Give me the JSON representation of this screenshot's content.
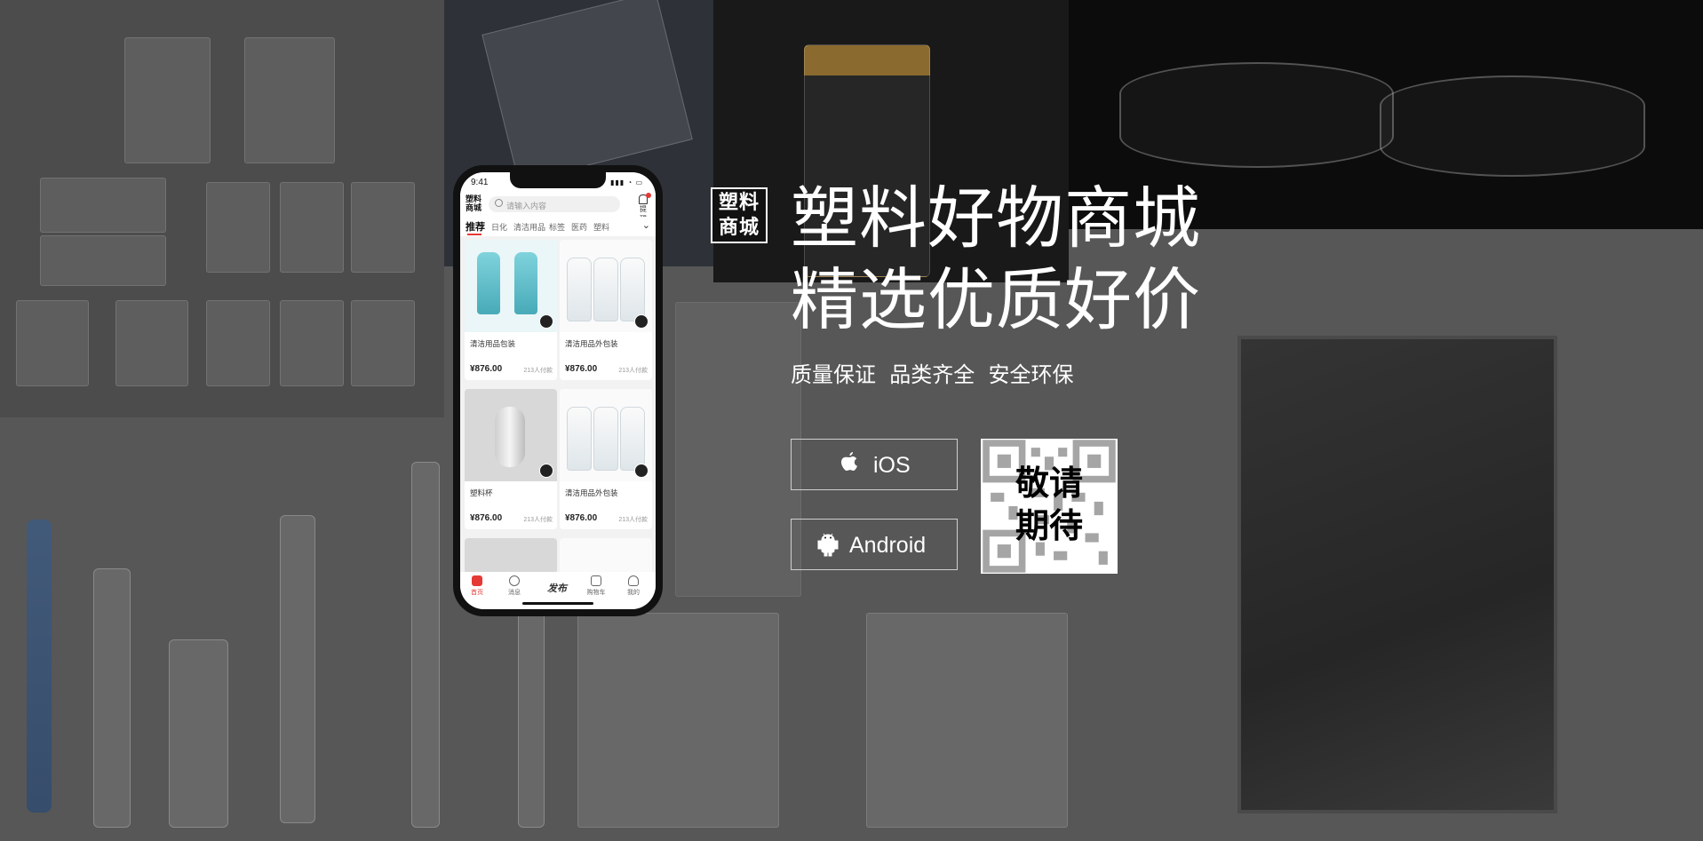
{
  "brand": {
    "logo_line1": "塑料",
    "logo_line2": "商城"
  },
  "hero": {
    "title_line1": "塑料好物商城",
    "title_line2": "精选优质好价",
    "subtitle": "质量保证  品类齐全  安全环保"
  },
  "downloads": {
    "ios_label": "iOS",
    "android_label": "Android"
  },
  "qr": {
    "text_line1": "敬请",
    "text_line2": "期待"
  },
  "phone": {
    "status_time": "9:41",
    "app_logo_line1": "塑料",
    "app_logo_line2": "商城",
    "search_placeholder": "请输入内容",
    "bell_label": "提醒",
    "tabs": [
      "推荐",
      "日化",
      "清洁用品",
      "标签",
      "医药",
      "塑料"
    ],
    "products": [
      {
        "name": "清洁用品包装",
        "price": "¥876.00",
        "sold": "213人付款"
      },
      {
        "name": "清洁用品外包装",
        "price": "¥876.00",
        "sold": "213人付款"
      },
      {
        "name": "塑料杯",
        "price": "¥876.00",
        "sold": "213人付款"
      },
      {
        "name": "清洁用品外包装",
        "price": "¥876.00",
        "sold": "213人付款"
      }
    ],
    "tabbar": [
      "首页",
      "消息",
      "发布",
      "购物车",
      "我的"
    ]
  },
  "colors": {
    "accent": "#e53935",
    "background": "#575757"
  }
}
